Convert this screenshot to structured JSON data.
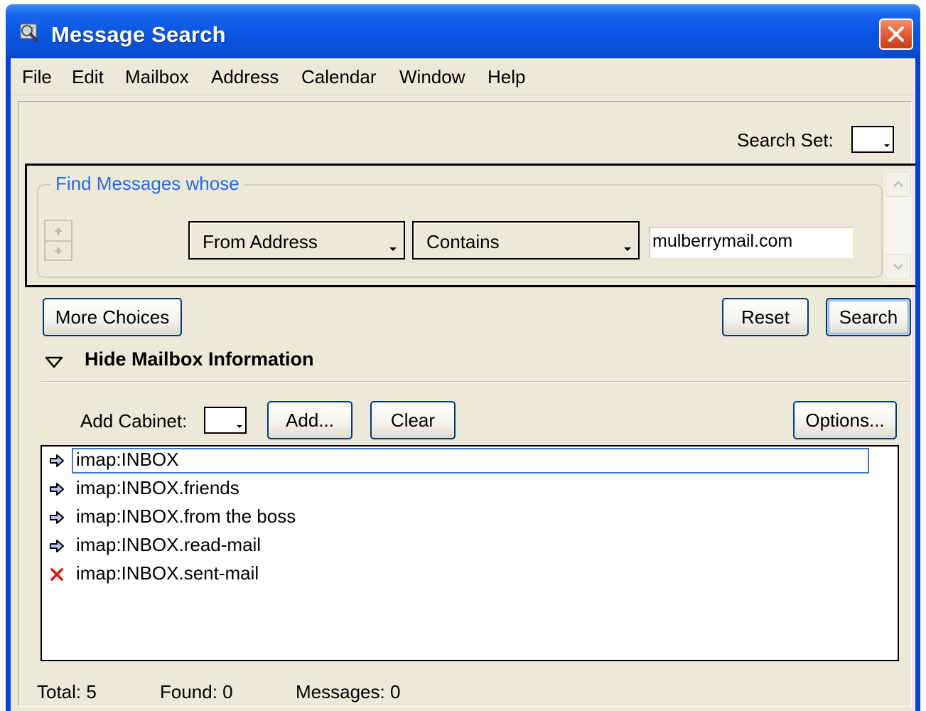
{
  "window": {
    "title": "Message Search",
    "icon": "magnifier-search-icon",
    "colors": {
      "titlebar": "#0a56e0",
      "close": "#e2552e",
      "face": "#ece9d8",
      "accent": "#2b6ade"
    }
  },
  "menu": [
    "File",
    "Edit",
    "Mailbox",
    "Address",
    "Calendar",
    "Window",
    "Help"
  ],
  "search_set": {
    "label": "Search Set:"
  },
  "criteria": {
    "legend": "Find Messages whose",
    "field": "From Address",
    "operator": "Contains",
    "value": "mulberrymail.com"
  },
  "buttons": {
    "more_choices": "More Choices",
    "reset": "Reset",
    "search": "Search",
    "add": "Add...",
    "clear": "Clear",
    "options": "Options..."
  },
  "mailbox_section": {
    "toggle_label": "Hide Mailbox Information",
    "add_cabinet_label": "Add Cabinet:"
  },
  "mailboxes": [
    {
      "name": "imap:INBOX",
      "icon": "arrow-right-icon",
      "selected": true
    },
    {
      "name": "imap:INBOX.friends",
      "icon": "arrow-right-icon"
    },
    {
      "name": "imap:INBOX.from the boss",
      "icon": "arrow-right-icon"
    },
    {
      "name": "imap:INBOX.read-mail",
      "icon": "arrow-right-icon"
    },
    {
      "name": "imap:INBOX.sent-mail",
      "icon": "red-x-icon"
    }
  ],
  "status": {
    "total": "Total: 5",
    "found": "Found: 0",
    "messages": "Messages: 0"
  }
}
